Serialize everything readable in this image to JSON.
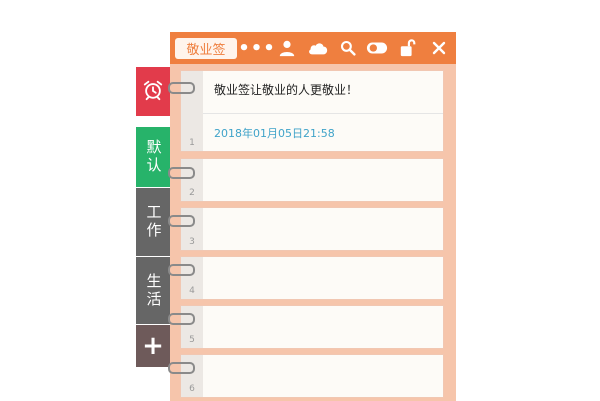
{
  "header": {
    "title": "敬业签",
    "icons": [
      "more-icon",
      "user-icon",
      "cloud-icon",
      "search-icon",
      "toggle-icon",
      "unlock-icon",
      "close-icon"
    ],
    "color": "#ef7f3f"
  },
  "tabs": [
    {
      "name": "alarm",
      "icon": "alarm-clock-icon",
      "color": "#e23b4b"
    },
    {
      "name": "default",
      "label": "默认",
      "color": "#27b36a"
    },
    {
      "name": "work",
      "label": "工作",
      "color": "#666666"
    },
    {
      "name": "life",
      "label": "生活",
      "color": "#666666"
    },
    {
      "name": "add",
      "label": "+",
      "color": "#6e5a5a"
    }
  ],
  "notes": [
    {
      "number": "1",
      "text": "敬业签让敬业的人更敬业！",
      "date": "2018年01月05日21:58"
    },
    {
      "number": "2"
    },
    {
      "number": "3"
    },
    {
      "number": "4"
    },
    {
      "number": "5"
    },
    {
      "number": "6"
    }
  ]
}
